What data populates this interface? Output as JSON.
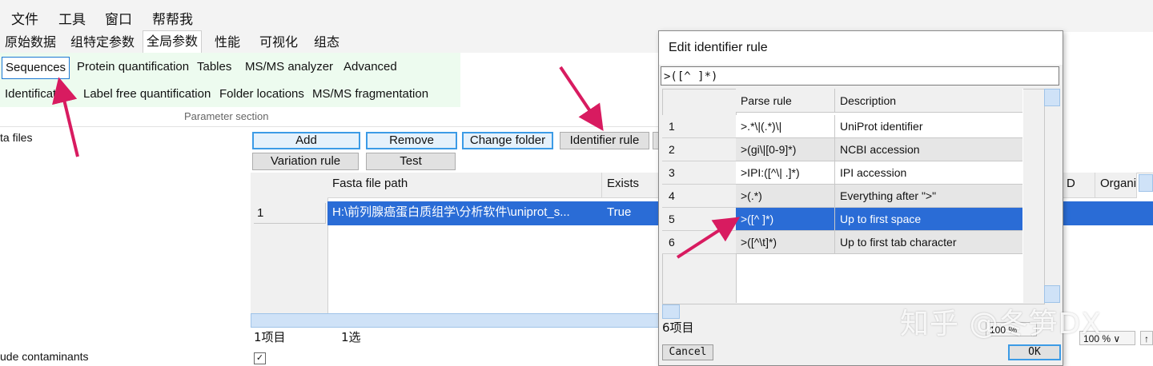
{
  "menu": [
    "文件",
    "工具",
    "窗口",
    "帮帮我"
  ],
  "tabs": [
    "原始数据",
    "组特定参数",
    "全局参数",
    "性能",
    "可视化",
    "组态"
  ],
  "subtabs_row1": [
    "Sequences",
    "Protein quantification",
    "Tables",
    "MS/MS analyzer",
    "Advanced"
  ],
  "subtabs_row2": [
    "Identificat",
    "Label free quantification",
    "Folder locations",
    "MS/MS fragmentation"
  ],
  "param_caption": "Parameter section",
  "left_labels": {
    "fasta": "ta files",
    "contaminants": "ude contaminants"
  },
  "buttons": {
    "add": "Add",
    "remove": "Remove",
    "change_folder": "Change folder",
    "identifier_rule": "Identifier rule",
    "variation_rule": "Variation rule",
    "test": "Test"
  },
  "grid": {
    "columns": [
      "Fasta file path",
      "Exists"
    ],
    "right_columns": [
      "D",
      "Organi"
    ],
    "rows": [
      {
        "num": "1",
        "path": "H:\\前列腺癌蛋白质组学\\分析软件\\uniprot_s...",
        "exists": "True"
      }
    ]
  },
  "status": {
    "items": "1项目",
    "selected": "1选"
  },
  "zoom": "100 %",
  "zoom_arrow": "∨",
  "up_arrow": "↑",
  "dialog": {
    "title": "Edit identifier rule",
    "input_value": ">([^ ]*)",
    "columns": [
      "Parse rule",
      "Description"
    ],
    "rows": [
      {
        "num": "1",
        "rule": ">.*\\|(.*)\\|",
        "desc": "UniProt identifier"
      },
      {
        "num": "2",
        "rule": ">(gi\\|[0-9]*)",
        "desc": "NCBI accession"
      },
      {
        "num": "3",
        "rule": ">IPI:([^\\| .]*)",
        "desc": "IPI accession"
      },
      {
        "num": "4",
        "rule": ">(.*)",
        "desc": "Everything after \">\""
      },
      {
        "num": "5",
        "rule": ">([^ ]*)",
        "desc": "Up to first space"
      },
      {
        "num": "6",
        "rule": ">([^\\t]*)",
        "desc": "Up to first tab character"
      }
    ],
    "selected_row": 5,
    "count": "6项目",
    "cancel": "Cancel",
    "ok": "OK",
    "zoom": "100 %"
  },
  "watermark": "知乎 @冬笋DX",
  "accent_color": "#2a6cd6",
  "arrow_color": "#d81b60"
}
